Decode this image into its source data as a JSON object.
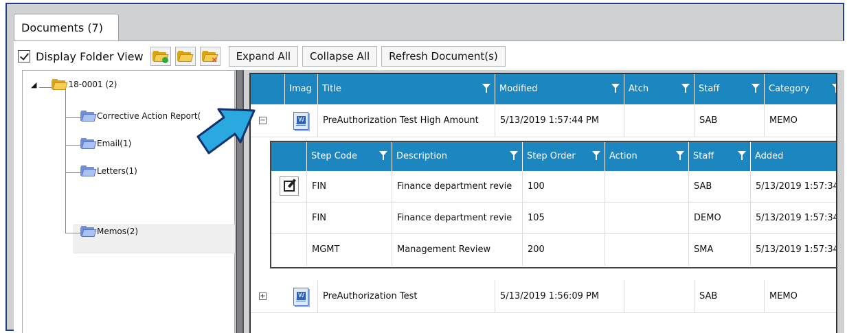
{
  "window": {
    "tab_label": "Documents (7)"
  },
  "toolbar": {
    "display_folder_view_label": "Display Folder View",
    "display_folder_view_checked": true,
    "expand_all_label": "Expand All",
    "collapse_all_label": "Collapse All",
    "refresh_label": "Refresh Document(s)"
  },
  "tree": {
    "root": {
      "label": "18-0001 (2)"
    },
    "children": [
      {
        "label": "Corrective Action Report("
      },
      {
        "label": "Email(1)"
      },
      {
        "label": "Letters(1)"
      },
      {
        "label": "Memos(2)",
        "selected": true
      }
    ]
  },
  "grid": {
    "columns": [
      "Imag",
      "Title",
      "Modified",
      "Atch",
      "Staff",
      "Category"
    ],
    "rows": [
      {
        "expander": "−",
        "title": "PreAuthorization Test High Amount",
        "modified": "5/13/2019 1:57:44 PM",
        "atch": "",
        "staff": "SAB",
        "category": "MEMO"
      },
      {
        "expander": "+",
        "title": "PreAuthorization Test",
        "modified": "5/13/2019 1:56:09 PM",
        "atch": "",
        "staff": "SAB",
        "category": "MEMO"
      }
    ]
  },
  "subgrid": {
    "columns": [
      "Step Code",
      "Description",
      "Step Order",
      "Action",
      "Staff",
      "Added"
    ],
    "rows": [
      {
        "step_code": "FIN",
        "description": "Finance department revie",
        "step_order": "100",
        "action": "",
        "staff": "SAB",
        "added": "5/13/2019 1:57:34"
      },
      {
        "step_code": "FIN",
        "description": "Finance department revie",
        "step_order": "105",
        "action": "",
        "staff": "DEMO",
        "added": "5/13/2019 1:57:34"
      },
      {
        "step_code": "MGMT",
        "description": "Management Review",
        "step_order": "200",
        "action": "",
        "staff": "SMA",
        "added": "5/13/2019 1:57:34"
      }
    ]
  },
  "colors": {
    "header_blue": "#1b86bf",
    "frame_border": "#1f3f8a",
    "callout_arrow": "#2aa8e0"
  }
}
